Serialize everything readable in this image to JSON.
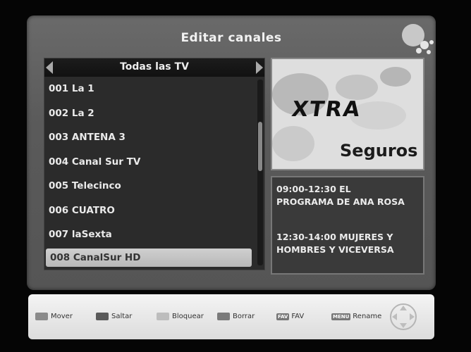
{
  "title": "Editar canales",
  "channel_list": {
    "title": "Todas las TV",
    "channels": [
      "001 La 1",
      "002 La 2",
      "003 ANTENA 3",
      "004 Canal Sur TV",
      "005 Telecinco",
      "006 CUATRO",
      "007 laSexta",
      "008 CanalSur HD"
    ],
    "selected_index": 7
  },
  "preview": {
    "logo": "XTRA",
    "subtitle": "Seguros"
  },
  "epg": [
    {
      "line1": "09:00-12:30  EL",
      "line2": "PROGRAMA DE ANA ROSA"
    },
    {
      "line1": "12:30-14:00  MUJERES Y",
      "line2": "HOMBRES Y VICEVERSA"
    }
  ],
  "footer": {
    "keys": [
      {
        "label": "Mover",
        "color": "#8a8a8a"
      },
      {
        "label": "Saltar",
        "color": "#5a5a5a"
      },
      {
        "label": "Bloquear",
        "color": "#bdbdbd"
      },
      {
        "label": "Borrar",
        "color": "#7a7a7a"
      },
      {
        "label": "FAV",
        "badge": "FAV"
      },
      {
        "label": "Rename",
        "badge": "MENU"
      }
    ]
  },
  "colors": {
    "panel": "#5e5e5e",
    "list_background": "#2b2b2b",
    "selected_row": "#c4c4c4",
    "footer": "#e8e8e8"
  }
}
